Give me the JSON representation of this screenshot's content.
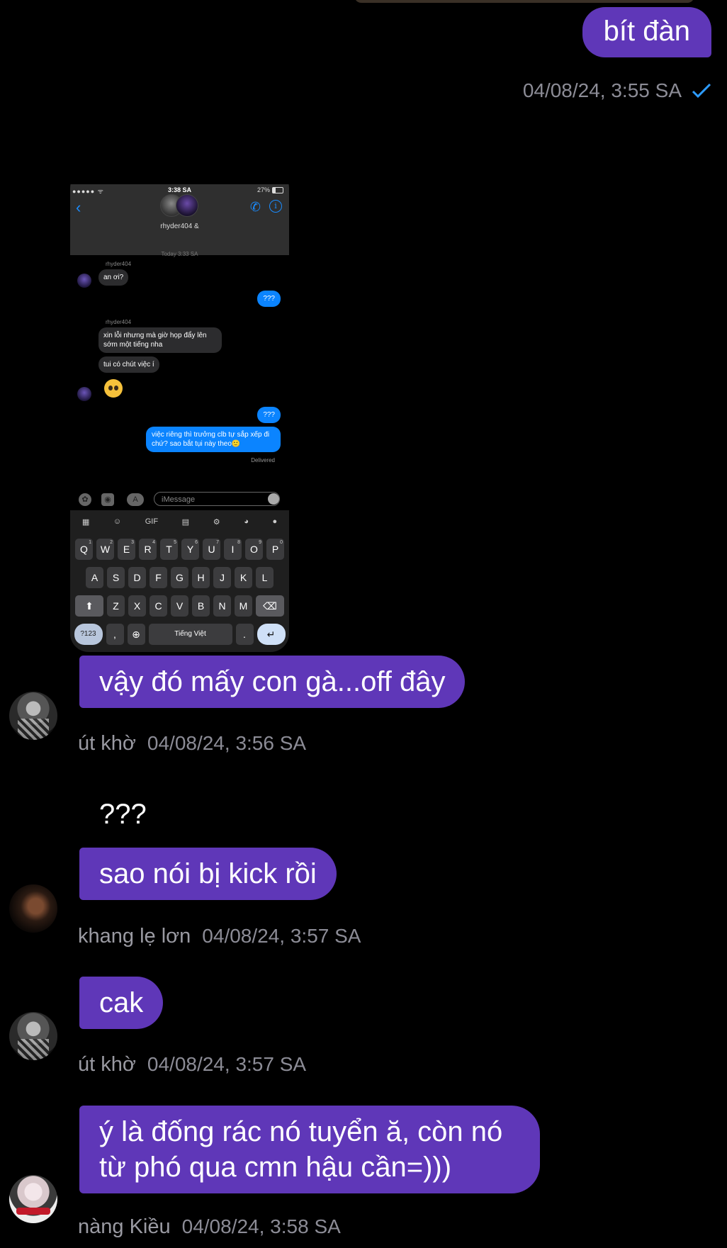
{
  "outgoing": {
    "text": "bít đàn",
    "timestamp": "04/08/24, 3:55 SA",
    "status_icon": "single-check-icon",
    "check_color": "#2d9cff"
  },
  "shared_screenshot": {
    "status_bar": {
      "signal": "●●●●● ᯤ",
      "time": "3:38 SA",
      "battery": "27%"
    },
    "header": {
      "name": "rhyder404 &"
    },
    "date_label": "Today 3:33 SA",
    "messages": {
      "sender1": "rhyder404",
      "m1": "an ơi?",
      "m2": "???",
      "sender2": "rhyder404",
      "m3": "xin lỗi nhưng mà giờ họp đẩy lên sớm một tiếng nha",
      "m4": "tui có chút việc í",
      "m5": "???",
      "m6": "việc riêng thì trưởng clb tự sắp xếp đi chứ? sao bắt tụi này theo🙂",
      "delivered": "Delivered"
    },
    "input_placeholder": "iMessage",
    "keyboard": {
      "row1": [
        "Q",
        "W",
        "E",
        "R",
        "T",
        "Y",
        "U",
        "I",
        "O",
        "P"
      ],
      "row1_nums": [
        "1",
        "2",
        "3",
        "4",
        "5",
        "6",
        "7",
        "8",
        "9",
        "0"
      ],
      "row2": [
        "A",
        "S",
        "D",
        "F",
        "G",
        "H",
        "J",
        "K",
        "L"
      ],
      "row3": [
        "Z",
        "X",
        "C",
        "V",
        "B",
        "N",
        "M"
      ],
      "num_key": "?123",
      "comma_key": ",",
      "space_label": "Tiếng Việt",
      "period_key": ".",
      "toolbar_gif": "GIF"
    }
  },
  "messages": [
    {
      "sender": "út khờ",
      "text": "vậy đó mấy con gà...off đây",
      "timestamp": "04/08/24, 3:56 SA"
    },
    {
      "sender": "khang lẹ lơn",
      "plain": "???",
      "text": "sao nói bị kick rồi",
      "timestamp": "04/08/24, 3:57 SA"
    },
    {
      "sender": "út khờ",
      "text": "cak",
      "timestamp": "04/08/24, 3:57 SA"
    },
    {
      "sender": "nàng Kiều",
      "text": "ý là đống rác nó tuyển ă, còn nó từ phó qua cmn hậu cần=)))",
      "timestamp": "04/08/24, 3:58 SA"
    }
  ],
  "colors": {
    "bubble": "#5f37b8",
    "background": "#000000",
    "meta": "#8c8c96"
  }
}
